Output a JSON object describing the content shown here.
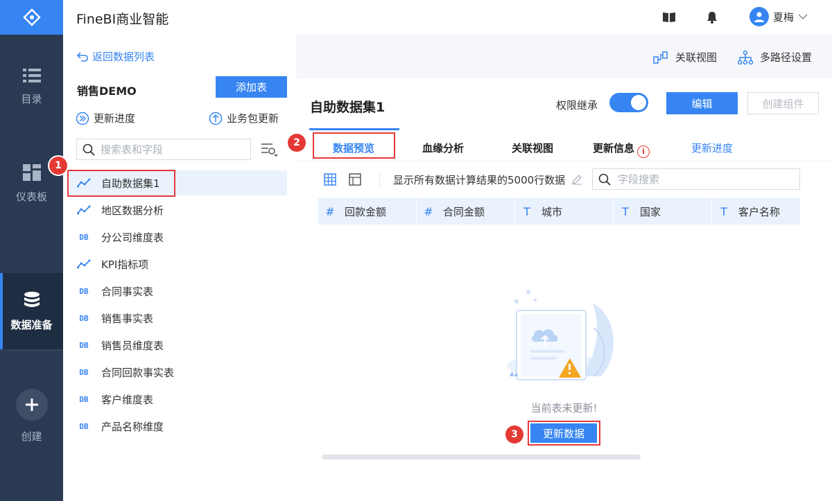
{
  "app": {
    "title": "FineBI商业智能"
  },
  "header": {
    "user_name": "夏梅"
  },
  "nav": {
    "items": [
      {
        "label": "目录",
        "icon": "list-icon"
      },
      {
        "label": "仪表板",
        "icon": "dashboard-icon"
      },
      {
        "label": "数据准备",
        "icon": "database-icon",
        "active": true
      },
      {
        "label": "创建",
        "icon": "plus-icon"
      }
    ]
  },
  "left_panel": {
    "back_label": "返回数据列表",
    "package_title": "销售DEMO",
    "add_table_label": "添加表",
    "update_progress_label": "更新进度",
    "package_update_label": "业务包更新",
    "search_placeholder": "搜索表和字段",
    "tables": [
      {
        "name": "自助数据集1",
        "type": "self-service"
      },
      {
        "name": "地区数据分析",
        "type": "self-service"
      },
      {
        "name": "分公司维度表",
        "type": "db"
      },
      {
        "name": "KPI指标项",
        "type": "self-service"
      },
      {
        "name": "合同事实表",
        "type": "db"
      },
      {
        "name": "销售事实表",
        "type": "db"
      },
      {
        "name": "销售员维度表",
        "type": "db"
      },
      {
        "name": "合同回款事实表",
        "type": "db"
      },
      {
        "name": "客户维度表",
        "type": "db"
      },
      {
        "name": "产品名称维度",
        "type": "db"
      }
    ],
    "db_tag": "DB"
  },
  "top_actions": {
    "relation_view": "关联视图",
    "multipath": "多路径设置"
  },
  "dataset": {
    "title": "自助数据集1",
    "permission_label": "权限继承",
    "permission_on": true,
    "edit_label": "编辑",
    "create_component_label": "创建组件",
    "tabs": [
      "数据预览",
      "血缘分析",
      "关联视图",
      "更新信息",
      "更新进度"
    ],
    "row_info": "显示所有数据计算结果的5000行数据",
    "field_search_placeholder": "字段搜索",
    "columns": [
      {
        "type": "#",
        "name": "回款金额"
      },
      {
        "type": "#",
        "name": "合同金额"
      },
      {
        "type": "T",
        "name": "城市"
      },
      {
        "type": "T",
        "name": "国家"
      },
      {
        "type": "T",
        "name": "客户名称"
      }
    ],
    "empty_text": "当前表未更新!",
    "update_button": "更新数据"
  },
  "steps": [
    "1",
    "2",
    "3"
  ],
  "colors": {
    "accent": "#3685f2",
    "nav_bg": "#2a3a52",
    "highlight": "#e5383b"
  }
}
